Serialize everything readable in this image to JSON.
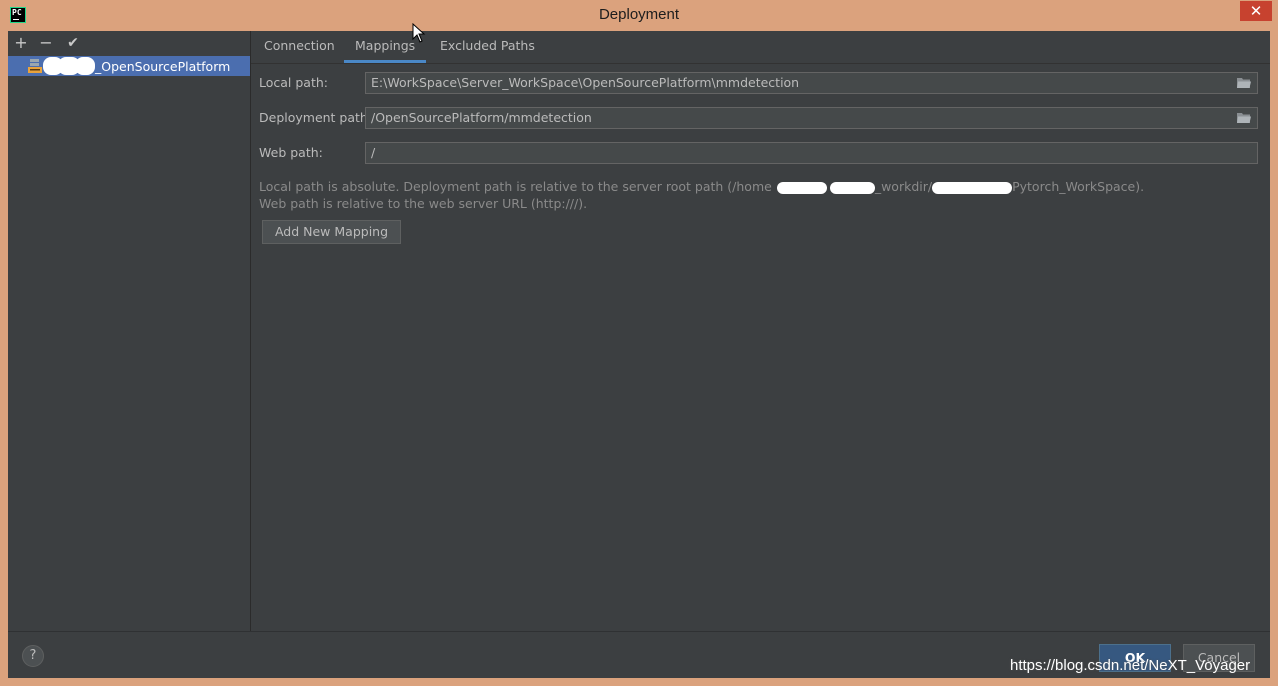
{
  "window": {
    "title": "Deployment",
    "close_glyph": "✕",
    "app_icon_text": "PC"
  },
  "toolbar": {
    "add_glyph": "+",
    "remove_glyph": "−",
    "apply_glyph": "✔"
  },
  "servers": [
    {
      "label": "_OpenSourcePlatform",
      "icon": "sftp-server-icon",
      "selected": true
    }
  ],
  "tabs": [
    {
      "label": "Connection",
      "active": false
    },
    {
      "label": "Mappings",
      "active": true
    },
    {
      "label": "Excluded Paths",
      "active": false
    }
  ],
  "mappings": {
    "local_path_label": "Local path:",
    "local_path_value": "E:\\WorkSpace\\Server_WorkSpace\\OpenSourcePlatform\\mmdetection",
    "deployment_path_label": "Deployment path:",
    "deployment_path_value": "/OpenSourcePlatform/mmdetection",
    "web_path_label": "Web path:",
    "web_path_value": "/",
    "hint_line1_a": "Local path is absolute. Deployment path is relative to the server root path (/home",
    "hint_line1_b": "_workdir/",
    "hint_line1_c": "Pytorch_WorkSpace).",
    "hint_line2": "Web path is relative to the web server URL (http:///).",
    "add_mapping_label": "Add New Mapping"
  },
  "footer": {
    "help_label": "?",
    "ok_label": "OK",
    "cancel_label": "Cancel"
  },
  "watermark": "https://blog.csdn.net/NeXT_Voyager",
  "colors": {
    "frame": "#dba27d",
    "background": "#3c3f41",
    "selection": "#4b6eaf",
    "tab_underline": "#4a88c7",
    "ok_button": "#365880",
    "close_button": "#c7422f"
  }
}
